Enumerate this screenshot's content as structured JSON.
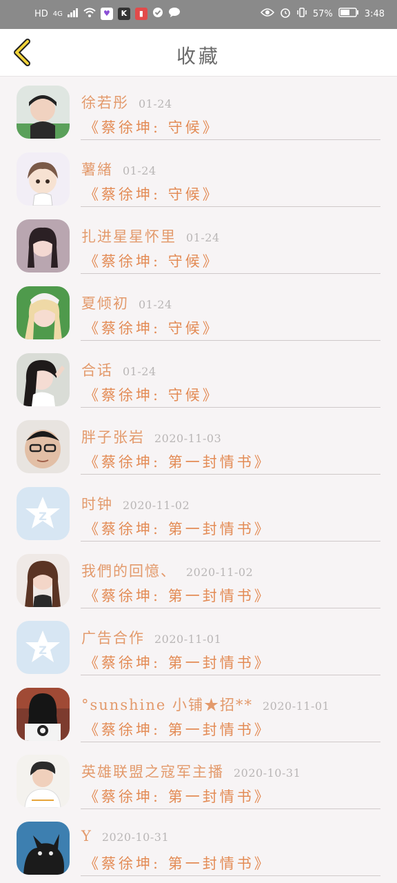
{
  "status_bar": {
    "hd": "HD",
    "signal": "4G",
    "battery": "57%",
    "time": "3:48"
  },
  "header": {
    "title": "收藏"
  },
  "favorites": [
    {
      "name": "徐若彤",
      "date": "01-24",
      "song": "《蔡徐坤: 守候》",
      "avatar": "avatar-girl-selfie"
    },
    {
      "name": "薯緖",
      "date": "01-24",
      "song": "《蔡徐坤: 守候》",
      "avatar": "avatar-cartoon-boy"
    },
    {
      "name": "扎进星星怀里",
      "date": "01-24",
      "song": "《蔡徐坤: 守候》",
      "avatar": "avatar-girl-braids"
    },
    {
      "name": "夏倾初",
      "date": "01-24",
      "song": "《蔡徐坤: 守候》",
      "avatar": "avatar-blonde-girl"
    },
    {
      "name": "合话",
      "date": "01-24",
      "song": "《蔡徐坤: 守候》",
      "avatar": "avatar-girl-peace-sign"
    },
    {
      "name": "胖子张岩",
      "date": "2020-11-03",
      "song": "《蔡徐坤: 第一封情书》",
      "avatar": "avatar-man-glasses"
    },
    {
      "name": "时钟",
      "date": "2020-11-02",
      "song": "《蔡徐坤: 第一封情书》",
      "avatar": "qq-default-avatar"
    },
    {
      "name": "我們的回憶、",
      "date": "2020-11-02",
      "song": "《蔡徐坤: 第一封情书》",
      "avatar": "avatar-girl-brown-hair"
    },
    {
      "name": "广告合作",
      "date": "2020-11-01",
      "song": "《蔡徐坤: 第一封情书》",
      "avatar": "qq-default-avatar"
    },
    {
      "name": "°sunshine 小铺★招**",
      "date": "2020-11-01",
      "song": "《蔡徐坤: 第一封情书》",
      "avatar": "avatar-girl-back"
    },
    {
      "name": "英雄联盟之寇军主播",
      "date": "2020-10-31",
      "song": "《蔡徐坤: 第一封情书》",
      "avatar": "avatar-boy-white-shirt"
    },
    {
      "name": "Y",
      "date": "2020-10-31",
      "song": "《蔡徐坤: 第一封情书》",
      "avatar": "avatar-black-cat"
    }
  ],
  "colors": {
    "accent": "#e38b55",
    "name": "#e39a6c",
    "date": "#b9b6b6",
    "back_arrow": "#f2d43a"
  }
}
